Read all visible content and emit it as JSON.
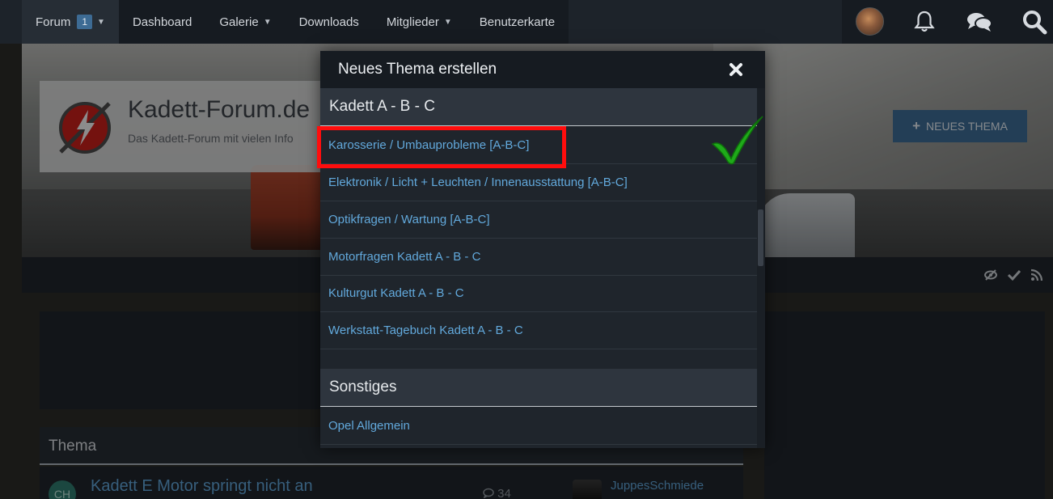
{
  "nav": {
    "items": [
      {
        "label": "Forum",
        "badge": "1",
        "chevron": true
      },
      {
        "label": "Dashboard",
        "chevron": false
      },
      {
        "label": "Galerie",
        "chevron": true
      },
      {
        "label": "Downloads",
        "chevron": false
      },
      {
        "label": "Mitglieder",
        "chevron": true
      },
      {
        "label": "Benutzerkarte",
        "chevron": false
      }
    ],
    "icons": [
      "user-avatar",
      "bell-icon",
      "chat-bubbles-icon",
      "search-icon"
    ]
  },
  "header": {
    "site_title": "Kadett-Forum.de",
    "site_subtitle": "Das Kadett-Forum mit vielen Info",
    "new_thread_label": "NEUES THEMA"
  },
  "toolbar": {
    "icons": [
      "eye-slash-icon",
      "checkmark-icon",
      "rss-icon"
    ]
  },
  "thread_list": {
    "header": "Thema",
    "rows": [
      {
        "avatar_initials": "CH",
        "title": "Kadett E Motor springt nicht an",
        "replies": "34",
        "last_user": "JuppesSchmiede"
      }
    ]
  },
  "dialog": {
    "title": "Neues Thema erstellen",
    "categories": [
      {
        "name": "Kadett A - B - C",
        "boards": [
          "Karosserie / Umbauprobleme [A-B-C]",
          "Elektronik / Licht + Leuchten / Innenausstattung [A-B-C]",
          "Optikfragen / Wartung [A-B-C]",
          "Motorfragen Kadett A - B - C",
          "Kulturgut Kadett A - B - C",
          "Werkstatt-Tagebuch Kadett A - B - C"
        ]
      },
      {
        "name": "Sonstiges",
        "boards": [
          "Opel Allgemein"
        ]
      }
    ]
  },
  "colors": {
    "accent": "#3d6b94",
    "link": "#62a9dc",
    "highlight_box": "#ff0d0d",
    "checkmark": "#1faa1a"
  }
}
